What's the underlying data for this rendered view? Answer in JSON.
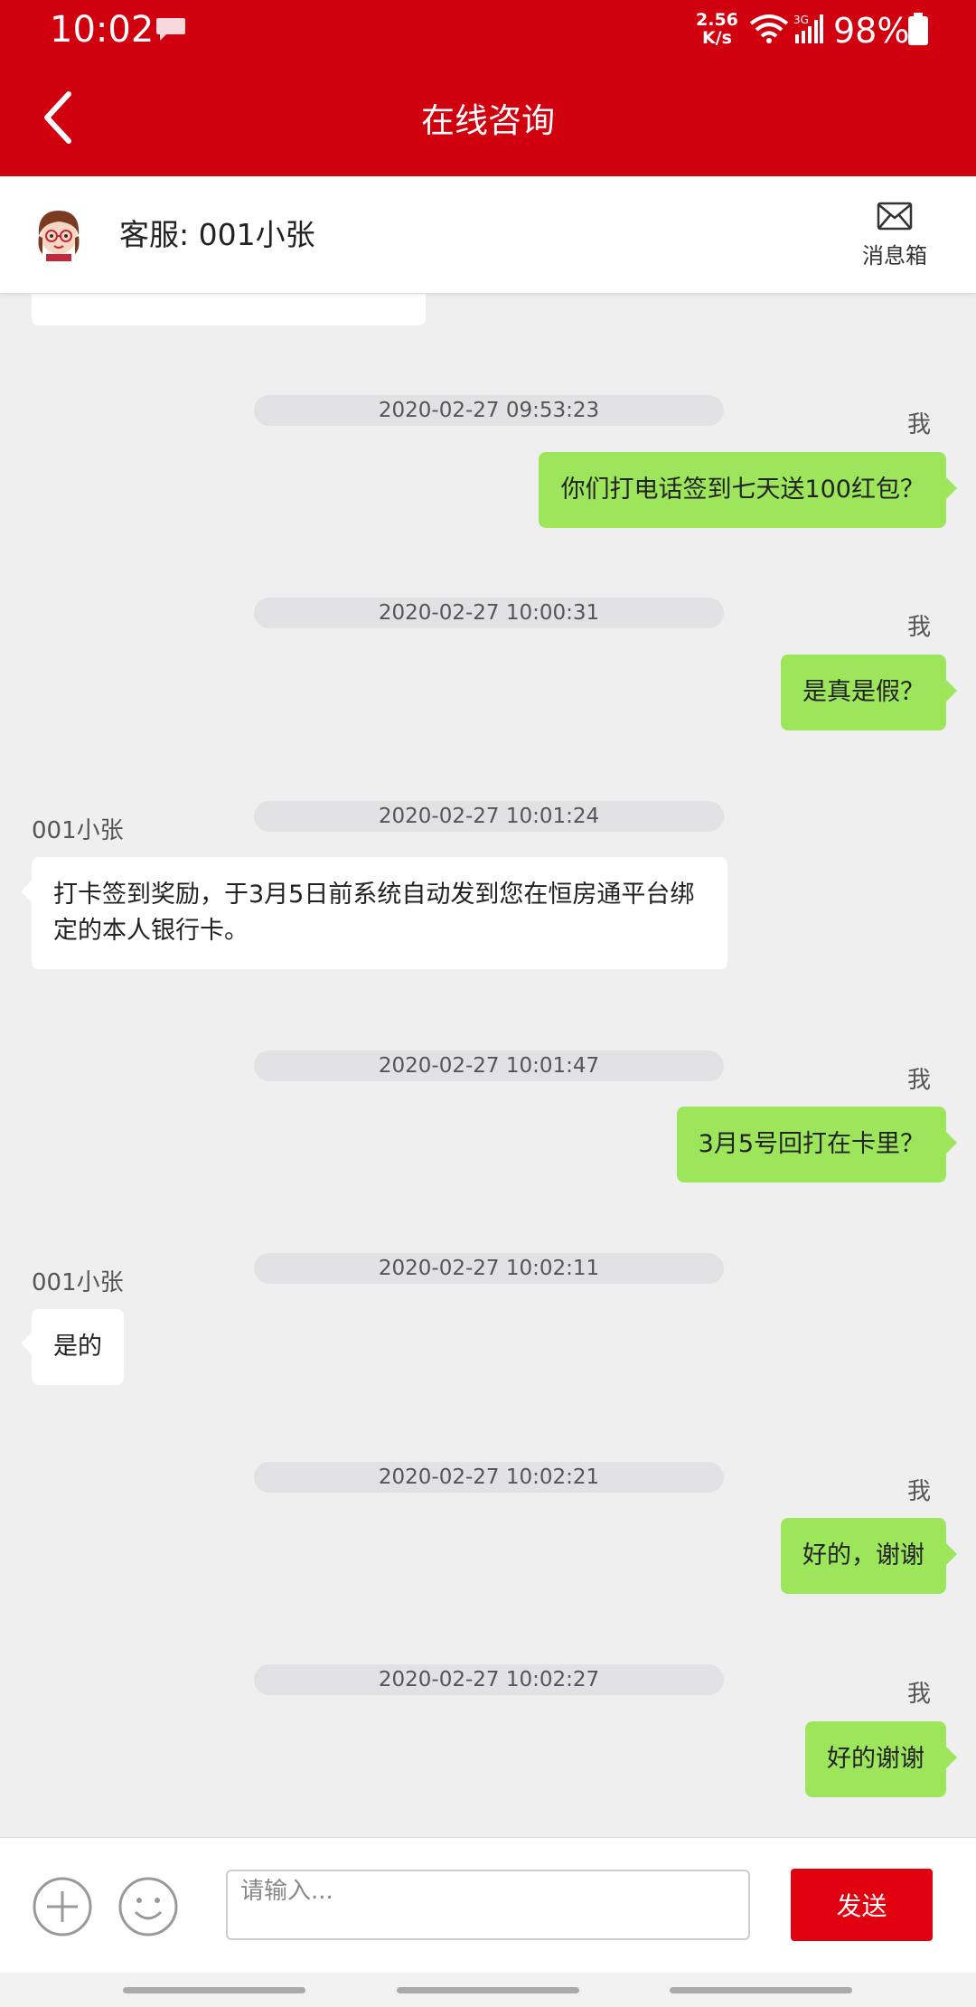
{
  "status_bar": {
    "time": "10:02",
    "speed_value": "2.56",
    "speed_unit": "K/s",
    "network": "3G",
    "battery": "98%"
  },
  "header": {
    "title": "在线咨询"
  },
  "agent": {
    "name": "客服: 001小张",
    "inbox_label": "消息箱"
  },
  "messages": [
    {
      "timestamp": "2020-02-27 09:53:23",
      "sender": "我",
      "side": "me",
      "text": "你们打电话签到七天送100红包？"
    },
    {
      "timestamp": "2020-02-27 10:00:31",
      "sender": "我",
      "side": "me",
      "text": "是真是假？"
    },
    {
      "timestamp": "2020-02-27 10:01:24",
      "sender": "001小张",
      "side": "them",
      "text": "打卡签到奖励，于3月5日前系统自动发到您在恒房通平台绑定的本人银行卡。"
    },
    {
      "timestamp": "2020-02-27 10:01:47",
      "sender": "我",
      "side": "me",
      "text": "3月5号回打在卡里？"
    },
    {
      "timestamp": "2020-02-27 10:02:11",
      "sender": "001小张",
      "side": "them",
      "text": "是的"
    },
    {
      "timestamp": "2020-02-27 10:02:21",
      "sender": "我",
      "side": "me",
      "text": "好的，谢谢"
    },
    {
      "timestamp": "2020-02-27 10:02:27",
      "sender": "我",
      "side": "me",
      "text": "好的谢谢"
    }
  ],
  "composer": {
    "placeholder": "请输入...",
    "send_label": "发送"
  },
  "icons": {
    "back": "chevron-left-icon",
    "inbox": "envelope-icon",
    "add": "plus-icon",
    "emoji": "smiley-icon"
  },
  "colors": {
    "brand_red": "#d0000f",
    "my_bubble": "#9de65c",
    "send_button": "#e0000f"
  }
}
